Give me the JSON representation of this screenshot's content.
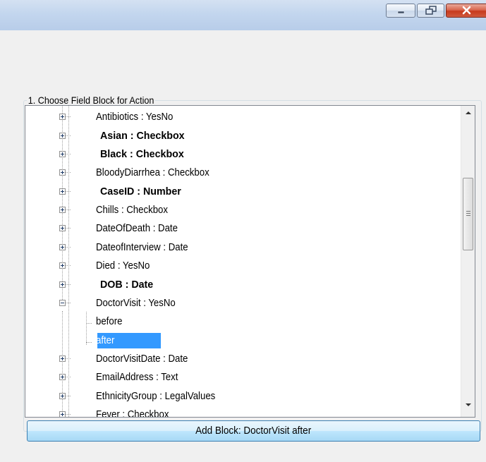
{
  "window": {
    "minimize_icon": "minimize-icon",
    "restore_icon": "restore-icon",
    "close_icon": "close-icon"
  },
  "group": {
    "label": "1. Choose Field Block for Action"
  },
  "tree": {
    "items": [
      {
        "label": "Antibiotics : YesNo",
        "bold": false,
        "expanded": false
      },
      {
        "label": "Asian : Checkbox",
        "bold": true,
        "expanded": false
      },
      {
        "label": "Black : Checkbox",
        "bold": true,
        "expanded": false
      },
      {
        "label": "BloodyDiarrhea : Checkbox",
        "bold": false,
        "expanded": false
      },
      {
        "label": "CaseID : Number",
        "bold": true,
        "expanded": false
      },
      {
        "label": "Chills : Checkbox",
        "bold": false,
        "expanded": false
      },
      {
        "label": "DateOfDeath : Date",
        "bold": false,
        "expanded": false
      },
      {
        "label": "DateofInterview : Date",
        "bold": false,
        "expanded": false
      },
      {
        "label": "Died : YesNo",
        "bold": false,
        "expanded": false
      },
      {
        "label": "DOB : Date",
        "bold": true,
        "expanded": false
      },
      {
        "label": "DoctorVisit : YesNo",
        "bold": false,
        "expanded": true
      },
      {
        "label": "before",
        "child": true
      },
      {
        "label": "after",
        "child": true,
        "selected": true
      },
      {
        "label": "DoctorVisitDate : Date",
        "bold": false,
        "expanded": false
      },
      {
        "label": "EmailAddress : Text",
        "bold": false,
        "expanded": false
      },
      {
        "label": "EthnicityGroup : LegalValues",
        "bold": false,
        "expanded": false
      },
      {
        "label": "Fever : Checkbox",
        "bold": false,
        "expanded": false
      }
    ]
  },
  "action_button": {
    "label": "Add Block: DoctorVisit after"
  }
}
